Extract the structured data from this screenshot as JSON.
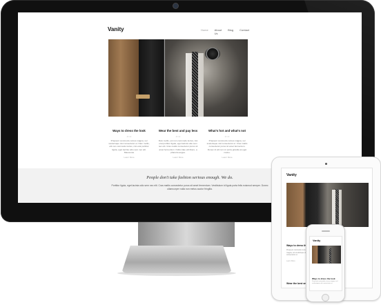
{
  "site": {
    "logo": "Vanity",
    "nav": [
      "Home",
      "About Us",
      "Blog",
      "Contact"
    ],
    "columns": [
      {
        "title": "Ways to dress the look",
        "dots": "• • •",
        "text": "Praesent commodo cursus magna, vel scelerisque nisl consectetur et. Nam mollis, elit non commodo luctus, nisi erat porttitor ligula, eget lacinia odio sem nec elit. Maecenas",
        "more": "Learn More"
      },
      {
        "title": "Wear the best and pay less",
        "dots": "• • •",
        "text": "Duis mollis, est non commodo luctus, nisi erat porttitor ligula, eget lacinia odio sem nec elit. Cras mattis consectetur purus sit amet fermentum. Nulla vitae elit libero, a pharetra augue.",
        "more": "Learn More"
      },
      {
        "title": "What's hot and what's not",
        "dots": "• • •",
        "text": "Praesent commodo cursus magna, vel scelerisque nisl consectetur et. Cras mattis consectetur purus sit amet fermentum. Donec id elit non mi porta gravida at eget metus.",
        "more": "Learn More"
      }
    ],
    "quote": "People don't take fashion serious enough. We do.",
    "quote_sub": "Porttitor ligula, eget lacinia odio sem nec elit. Cras mattis consectetur purus sit amet fermentum. Vestibulum id ligula porta felis euismod semper. Donec ullamcorper nulla non metus auctor fringilla."
  },
  "tablet": {
    "logo": "Vanity",
    "heading": "Ways to dress the look",
    "text": "Praesent commodo cursus magna, vel scelerisque nisl consectetur et.",
    "more": "Learn More",
    "heading2": "Wear the best and pay less"
  },
  "phone": {
    "logo": "Vanity",
    "heading": "Ways to dress the look",
    "text": "Praesent commodo cursus magna, vel scelerisque nisl consectetur et."
  },
  "colors": {
    "device_dark": "#101010",
    "quote_band": "#f2f2f2",
    "background": "#ffffff"
  }
}
